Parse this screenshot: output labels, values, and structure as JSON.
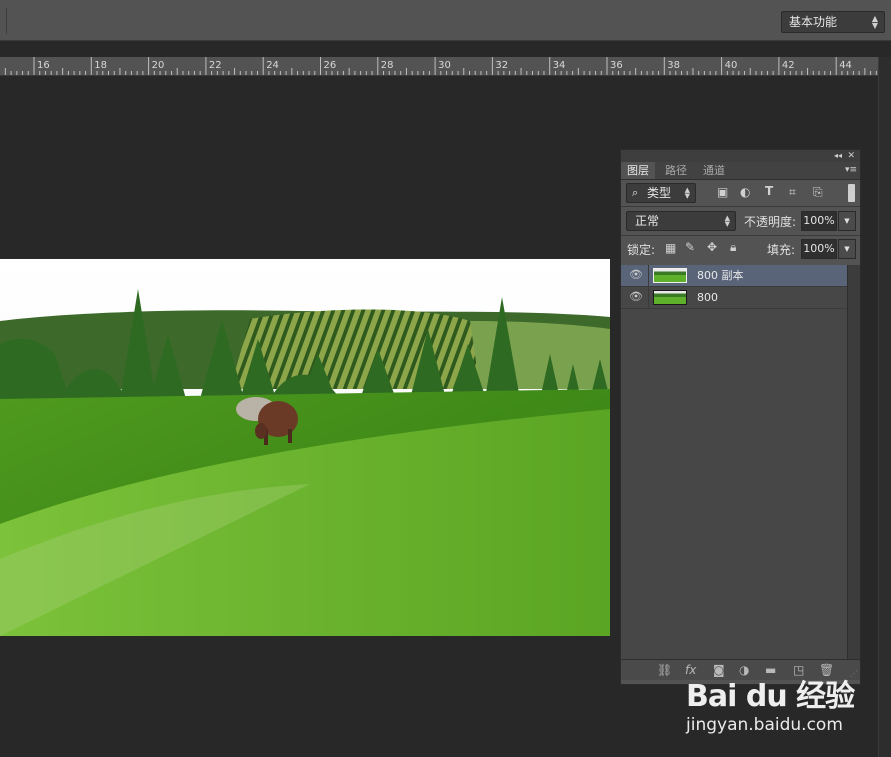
{
  "toolbar": {
    "workspace_label": "基本功能"
  },
  "ruler": {
    "labels": [
      "16",
      "18",
      "20",
      "22",
      "24",
      "26",
      "28",
      "30",
      "32",
      "34",
      "36",
      "38",
      "40",
      "42",
      "44"
    ]
  },
  "panel": {
    "tabs": [
      "图层",
      "路径",
      "通道"
    ],
    "filter": {
      "kind_label": "类型"
    },
    "blend_mode": "正常",
    "opacity_label": "不透明度:",
    "opacity_value": "100%",
    "lock_label": "锁定:",
    "fill_label": "填充:",
    "fill_value": "100%",
    "layers": [
      {
        "name": "800 副本",
        "selected": true,
        "visible": true
      },
      {
        "name": "800",
        "selected": false,
        "visible": true
      }
    ],
    "bottom": {
      "fx_label": "fx"
    }
  },
  "watermark": {
    "logo_text": "Bai du 经验",
    "url": "jingyan.baidu.com"
  },
  "colors": {
    "selected_layer": "#596479",
    "panel_bg": "#535353",
    "canvas_bg": "#282828"
  }
}
